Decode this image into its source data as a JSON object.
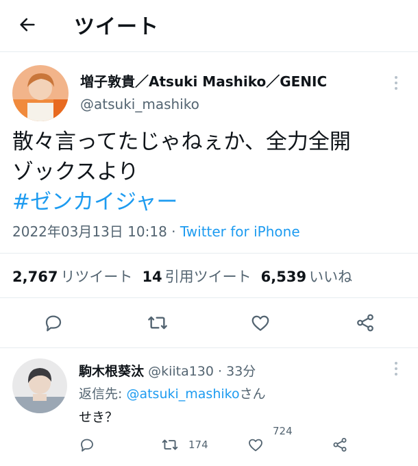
{
  "header": {
    "title": "ツイート",
    "back_icon": "arrow-left-icon"
  },
  "tweet": {
    "author_name": "増子敦貴／Atsuki Mashiko／GENIC",
    "author_handle": "@atsuki_mashiko",
    "text_line1": "散々言ってたじゃねぇか、全力全開",
    "text_line2": "ゾックスより",
    "hashtag": "#ゼンカイジャー",
    "timestamp": "2022年03月13日 10:18",
    "separator": " · ",
    "source": "Twitter for iPhone",
    "retweets_count": "2,767",
    "retweets_label": "リツイート",
    "quotes_count": "14",
    "quotes_label": "引用ツイート",
    "likes_count": "6,539",
    "likes_label": "いいね"
  },
  "reply": {
    "author_name": "駒木根葵汰",
    "author_handle": "@kiita130",
    "time_sep": " · ",
    "time": "33分",
    "reply_to_prefix": "返信先: ",
    "reply_to_handle": "@atsuki_mashiko",
    "reply_to_suffix": "さん",
    "text": "せき？",
    "retweet_count": "174",
    "like_count": "724"
  },
  "icons": {
    "reply": "reply-icon",
    "retweet": "retweet-icon",
    "like": "heart-icon",
    "share": "share-icon",
    "more": "more-vertical-icon"
  },
  "colors": {
    "link": "#1d9bf0",
    "muted": "#536471",
    "text": "#0f1419",
    "divider": "#e6ecf0"
  }
}
